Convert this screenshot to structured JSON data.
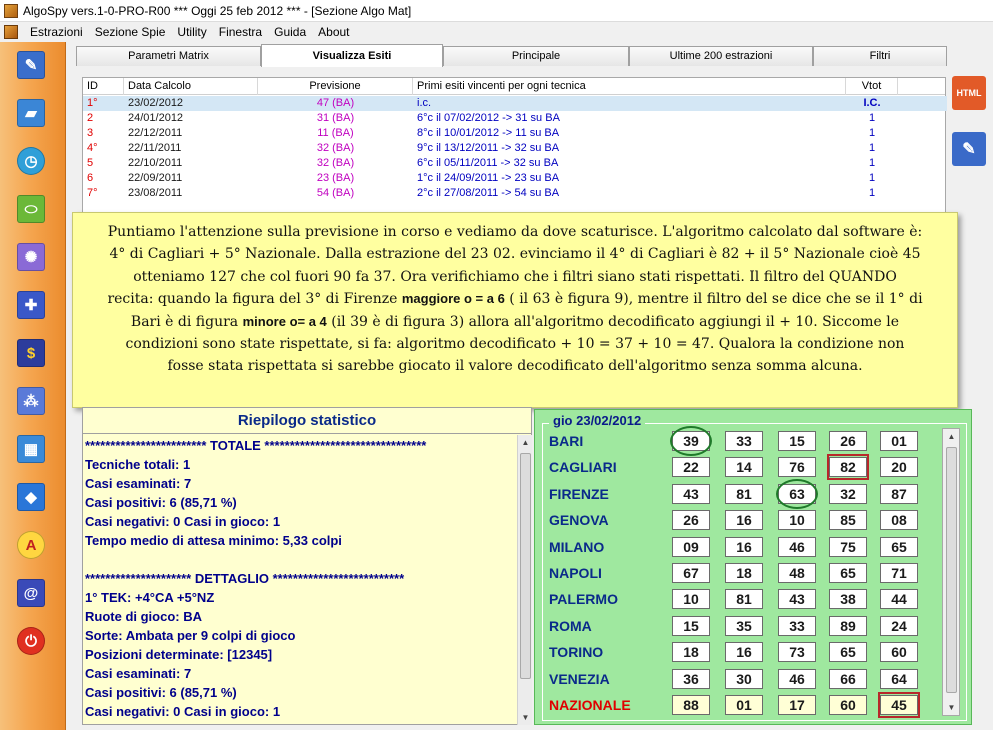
{
  "title": "AlgoSpy vers.1-0-PRO-R00  ***  Oggi 25 feb 2012  ***   - [Sezione Algo Mat]",
  "menu": [
    "Estrazioni",
    "Sezione Spie",
    "Utility",
    "Finestra",
    "Guida",
    "About"
  ],
  "tabs": [
    "Parametri Matrix",
    "Visualizza Esiti",
    "Principale",
    "Ultime 200 estrazioni",
    "Filtri"
  ],
  "active_tab": "Visualizza Esiti",
  "results": {
    "headers": [
      "ID",
      "Data Calcolo",
      "Previsione",
      "Primi esiti vincenti per ogni tecnica",
      "Vtot"
    ],
    "rows": [
      {
        "id": "1°",
        "data": "23/02/2012",
        "prev": "47 (BA)",
        "esito": "i.c.",
        "vtot": "I.C."
      },
      {
        "id": "2",
        "data": "24/01/2012",
        "prev": "31 (BA)",
        "esito": "6°c il 07/02/2012 -> 31 su BA",
        "vtot": "1"
      },
      {
        "id": "3",
        "data": "22/12/2011",
        "prev": "11 (BA)",
        "esito": "8°c il 10/01/2012 -> 11 su BA",
        "vtot": "1"
      },
      {
        "id": "4°",
        "data": "22/11/2011",
        "prev": "32 (BA)",
        "esito": "9°c il 13/12/2011 -> 32 su BA",
        "vtot": "1"
      },
      {
        "id": "5",
        "data": "22/10/2011",
        "prev": "32 (BA)",
        "esito": "6°c il 05/11/2011 -> 32 su BA",
        "vtot": "1"
      },
      {
        "id": "6",
        "data": "22/09/2011",
        "prev": "23 (BA)",
        "esito": "1°c il 24/09/2011 -> 23 su BA",
        "vtot": "1"
      },
      {
        "id": "7°",
        "data": "23/08/2011",
        "prev": "54 (BA)",
        "esito": "2°c il 27/08/2011 -> 54 su BA",
        "vtot": "1"
      }
    ]
  },
  "note": {
    "l1": "Puntiamo l'attenzione sulla previsione in corso e vediamo da dove scaturisce. L'algoritmo calcolato dal software è:",
    "l2": "4° di Cagliari + 5° Nazionale. Dalla estrazione del 23 02. evinciamo il 4° di Cagliari è 82 + il 5° Nazionale cioè 45",
    "l3": "otteniamo 127 che col fuori 90 fa 37. Ora verifichiamo che i filtri siano stati rispettati. Il filtro del QUANDO",
    "l4a": "recita: quando la figura del 3° di Firenze ",
    "l4b": "maggiore o = a 6",
    "l4c": " ( il 63 è figura 9), mentre il filtro del se dice che se il 1° di",
    "l5a": "Bari è di figura ",
    "l5b": "minore o= a 4",
    "l5c": " (il 39 è di figura 3) allora all'algoritmo decodificato aggiungi il + 10. Siccome le",
    "l6": "condizioni sono state rispettate, si fa: algoritmo decodificato + 10 = 37 + 10 = 47. Qualora la condizione non",
    "l7": "fosse stata rispettata si sarebbe giocato il valore decodificato dell'algoritmo senza somma alcuna."
  },
  "stats": {
    "title": "Riepilogo statistico",
    "lines": [
      "************************ TOTALE ********************************",
      "Tecniche totali: 1",
      "Casi esaminati: 7",
      "Casi positivi: 6 (85,71 %)",
      "Casi negativi: 0  Casi in gioco: 1",
      "Tempo medio di attesa minimo: 5,33 colpi",
      "",
      "********************* DETTAGLIO **************************",
      "1° TEK: +4°CA +5°NZ",
      "Ruote di gioco: BA",
      "Sorte: Ambata per 9 colpi di gioco",
      "Posizioni determinate: [12345]",
      "Casi esaminati: 7",
      "Casi positivi: 6 (85,71 %)",
      "Casi negativi: 0  Casi in gioco: 1"
    ]
  },
  "extraction": {
    "date": "gio 23/02/2012",
    "wheels": [
      {
        "name": "BARI",
        "nums": [
          "39",
          "33",
          "15",
          "26",
          "01"
        ]
      },
      {
        "name": "CAGLIARI",
        "nums": [
          "22",
          "14",
          "76",
          "82",
          "20"
        ]
      },
      {
        "name": "FIRENZE",
        "nums": [
          "43",
          "81",
          "63",
          "32",
          "87"
        ]
      },
      {
        "name": "GENOVA",
        "nums": [
          "26",
          "16",
          "10",
          "85",
          "08"
        ]
      },
      {
        "name": "MILANO",
        "nums": [
          "09",
          "16",
          "46",
          "75",
          "65"
        ]
      },
      {
        "name": "NAPOLI",
        "nums": [
          "67",
          "18",
          "48",
          "65",
          "71"
        ]
      },
      {
        "name": "PALERMO",
        "nums": [
          "10",
          "81",
          "43",
          "38",
          "44"
        ]
      },
      {
        "name": "ROMA",
        "nums": [
          "15",
          "35",
          "33",
          "89",
          "24"
        ]
      },
      {
        "name": "TORINO",
        "nums": [
          "18",
          "16",
          "73",
          "65",
          "60"
        ]
      },
      {
        "name": "VENEZIA",
        "nums": [
          "36",
          "30",
          "46",
          "66",
          "64"
        ]
      },
      {
        "name": "NAZIONALE",
        "nums": [
          "88",
          "01",
          "17",
          "60",
          "45"
        ]
      }
    ],
    "highlight_ring": [
      "BARI-1",
      "FIRENZE-3"
    ],
    "highlight_square": [
      "CAGLIARI-4",
      "NAZIONALE-5"
    ]
  },
  "icons": {
    "left_toolbar": [
      "pencil-icon",
      "book-icon",
      "clock-icon",
      "tube-icon",
      "lightbulb-icon",
      "cross-icon",
      "dollar-icon",
      "tree-icon",
      "calendar-icon",
      "drop-icon",
      "letter-a-icon",
      "notebook-icon",
      "power-icon"
    ],
    "right_toolbar": [
      "html-export-icon",
      "edit-document-icon"
    ]
  },
  "colors": {
    "id_red": "#e00000",
    "prev_magenta": "#c000c0",
    "esito_blue": "#0000c0",
    "nazionale_red": "#e00000",
    "stats_bg": "#ffffd0",
    "grid_bg": "#9fe89f"
  }
}
